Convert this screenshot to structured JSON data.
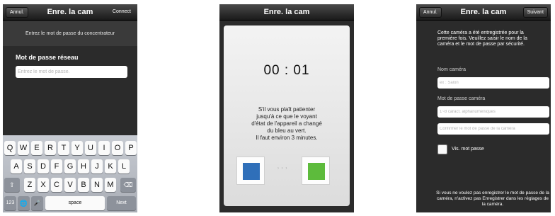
{
  "screen1": {
    "title": "Enre. la cam",
    "back_label": "Annul.",
    "action_label": "Connect",
    "hint": "Entrez le mot de passe du concentrateur",
    "field_label": "Mot de passe réseau",
    "field_placeholder": "Entrez le mot de passe.",
    "keyboard": {
      "row1": [
        "Q",
        "W",
        "E",
        "R",
        "T",
        "Y",
        "U",
        "I",
        "O",
        "P"
      ],
      "row2": [
        "A",
        "S",
        "D",
        "F",
        "G",
        "H",
        "J",
        "K",
        "L"
      ],
      "row3": [
        "Z",
        "X",
        "C",
        "V",
        "B",
        "N",
        "M"
      ],
      "numbers_key": "123",
      "space_key": "space",
      "next_key": "Next"
    }
  },
  "screen2": {
    "title": "Enre. la cam",
    "timer": "00 : 01",
    "message_lines": [
      "S'il vous plaît patienter",
      "jusqu'à ce que le voyant",
      "d'état de l'appareil a changé",
      "du bleu au vert.",
      "Il faut environ 3 minutes."
    ],
    "arrows": "› › ›",
    "colors": {
      "from": "#2f6fb9",
      "to": "#5dbb3c"
    }
  },
  "screen3": {
    "title": "Enre. la cam",
    "back_label": "Annul.",
    "next_label": "Suivant",
    "intro": "Cette caméra a été entregistrée pour la première fois. Veuillez saisir le nom de la caméra et le mot de passe par sécurité.",
    "name_label": "Nom caméra",
    "name_placeholder": "ex : Salon",
    "password_label": "Mot de passe caméra",
    "password_placeholder": "1~8 caract. alphanuméniques",
    "confirm_placeholder": "Confirmer le mot de passe de la caméra",
    "show_password_label": "Vis. mot passe",
    "footer": "Si vous ne voulez pas enregistrer le mot de passe de la caméra, n'activez pas Enregistrer dans les réglages de la caméra."
  }
}
